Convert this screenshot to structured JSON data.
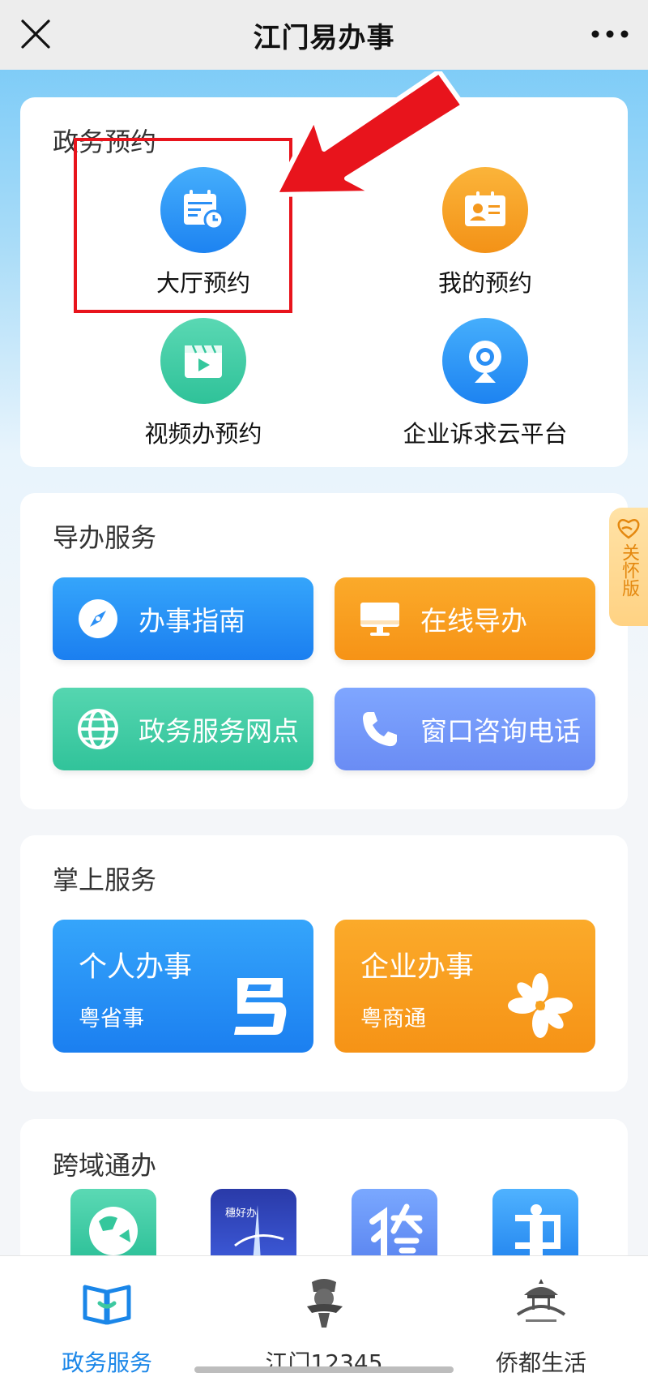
{
  "header": {
    "title": "江门易办事",
    "close_icon": "close-icon",
    "more_icon": "more-icon"
  },
  "appointment": {
    "title": "政务预约",
    "items": [
      {
        "label": "大厅预约",
        "icon": "calendar-clock-icon",
        "color": "#2f95f7"
      },
      {
        "label": "我的预约",
        "icon": "id-card-icon",
        "color": "#f7a21f"
      },
      {
        "label": "视频办预约",
        "icon": "video-play-icon",
        "color": "#35c79c"
      },
      {
        "label": "企业诉求云平台",
        "icon": "webcam-icon",
        "color": "#2f95f7"
      }
    ]
  },
  "guide": {
    "title": "导办服务",
    "items": [
      {
        "label": "办事指南",
        "icon": "compass-icon"
      },
      {
        "label": "在线导办",
        "icon": "monitor-icon"
      },
      {
        "label": "政务服务网点",
        "icon": "globe-icon"
      },
      {
        "label": "窗口咨询电话",
        "icon": "phone-icon"
      }
    ]
  },
  "mobile": {
    "title": "掌上服务",
    "items": [
      {
        "label": "个人办事",
        "sub": "粤省事",
        "icon": "yue-logo-icon"
      },
      {
        "label": "企业办事",
        "sub": "粤商通",
        "icon": "flower-logo-icon"
      }
    ]
  },
  "cross": {
    "title": "跨域通办",
    "tiles": [
      {
        "icon": "earth-app-icon"
      },
      {
        "icon": "suihaoban-app-icon",
        "text": "穗好办"
      },
      {
        "icon": "tu-app-icon"
      },
      {
        "icon": "map-app-icon"
      }
    ]
  },
  "care_mode": {
    "label": "关怀版",
    "icon": "heart-hand-icon"
  },
  "tabbar": {
    "items": [
      {
        "label": "政务服务",
        "icon": "book-icon",
        "active": true
      },
      {
        "label": "江门12345",
        "icon": "mascot-icon",
        "active": false
      },
      {
        "label": "侨都生活",
        "icon": "pavilion-icon",
        "active": false
      }
    ]
  },
  "colors": {
    "accent": "#1a86e8",
    "highlight": "#e8141c"
  }
}
